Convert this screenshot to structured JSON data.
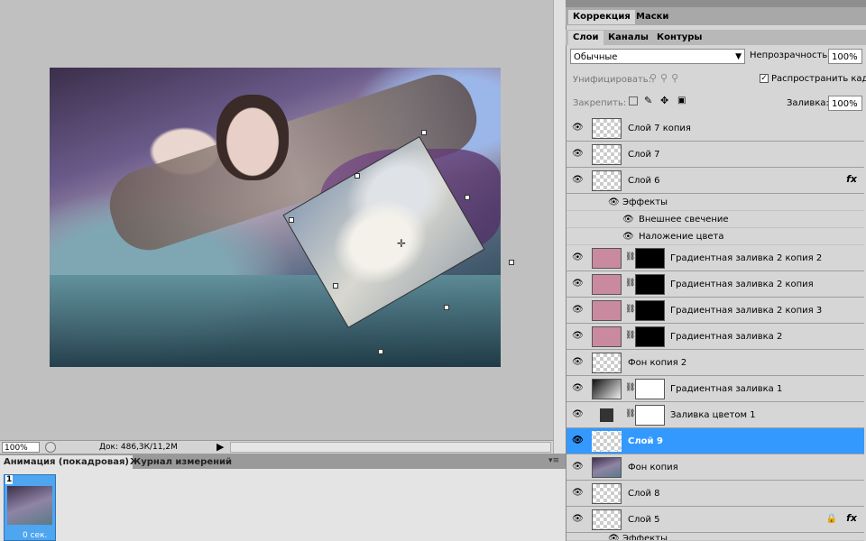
{
  "canvas": {
    "title": "canvas"
  },
  "status": {
    "zoom": "100%",
    "doc": "Док: 486,3К/11,2М"
  },
  "animation": {
    "tabs": [
      "Анимация (покадровая)",
      "Журнал измерений"
    ],
    "frame": {
      "number": "1",
      "delay": "0 сек."
    }
  },
  "panel": {
    "top_tabs": [
      "Коррекция",
      "Маски"
    ],
    "layer_tabs": [
      "Слои",
      "Каналы",
      "Контуры"
    ],
    "blend_mode": "Обычные",
    "opacity_label": "Непрозрачность:",
    "opacity_value": "100%",
    "unify_label": "Унифицировать:",
    "propagate_label": "Распространить кадр",
    "lock_label": "Закрепить:",
    "fill_label": "Заливка:",
    "fill_value": "100%",
    "fx_glyph": "fx",
    "layers": [
      {
        "name": "Слой 7 копия"
      },
      {
        "name": "Слой 7"
      },
      {
        "name": "Слой 6"
      },
      {
        "name": "Градиентная заливка 2 копия 2"
      },
      {
        "name": "Градиентная заливка 2 копия"
      },
      {
        "name": "Градиентная заливка 2 копия 3"
      },
      {
        "name": "Градиентная заливка 2"
      },
      {
        "name": "Фон копия 2"
      },
      {
        "name": "Градиентная заливка 1"
      },
      {
        "name": "Заливка цветом 1"
      },
      {
        "name": "Слой 9"
      },
      {
        "name": "Фон копия"
      },
      {
        "name": "Слой 8"
      },
      {
        "name": "Слой 5"
      }
    ],
    "effects": {
      "title": "Эффекты",
      "items": [
        "Внешнее свечение",
        "Наложение цвета"
      ]
    },
    "effects2": "Эффекты"
  },
  "colors": {
    "selection": "#3399ff",
    "panel_bg": "#d6d6d6",
    "workspace": "#c0c0c0"
  }
}
